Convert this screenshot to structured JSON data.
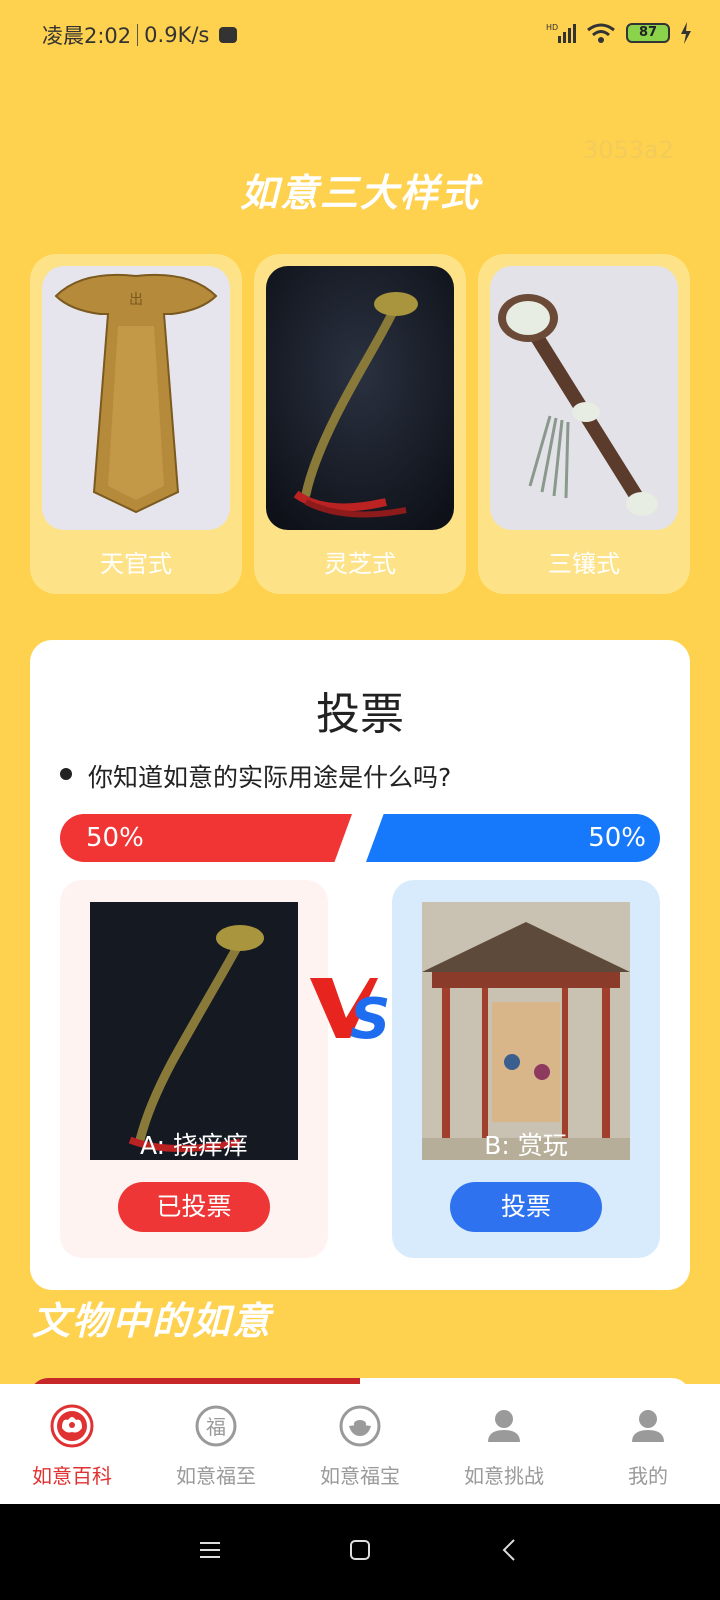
{
  "status_bar": {
    "time": "凌晨2:02",
    "speed": "0.9K/s",
    "battery": "87"
  },
  "watermark": "3053a2",
  "styles_section": {
    "title": "如意三大样式",
    "cards": [
      {
        "label": "天官式"
      },
      {
        "label": "灵芝式"
      },
      {
        "label": "三镶式"
      }
    ]
  },
  "vote": {
    "title": "投票",
    "question": "你知道如意的实际用途是什么吗?",
    "left_percent": "50%",
    "right_percent": "50%",
    "option_a": {
      "caption": "A: 挠痒痒",
      "button": "已投票"
    },
    "option_b": {
      "caption": "B: 赏玩",
      "button": "投票"
    },
    "colors": {
      "red": "#F13534",
      "blue": "#1679FB"
    }
  },
  "relics_section": {
    "title": "文物中的如意"
  },
  "tabbar": {
    "items": [
      {
        "label": "如意百科",
        "icon": "ruyi-cloud-icon",
        "active": true
      },
      {
        "label": "如意福至",
        "icon": "fu-character-icon",
        "active": false
      },
      {
        "label": "如意福宝",
        "icon": "treasure-ingot-icon",
        "active": false
      },
      {
        "label": "如意挑战",
        "icon": "user-icon",
        "active": false
      },
      {
        "label": "我的",
        "icon": "user-icon",
        "active": false
      }
    ]
  },
  "theme": {
    "background": "#FED14F",
    "accent": "#E03232"
  }
}
